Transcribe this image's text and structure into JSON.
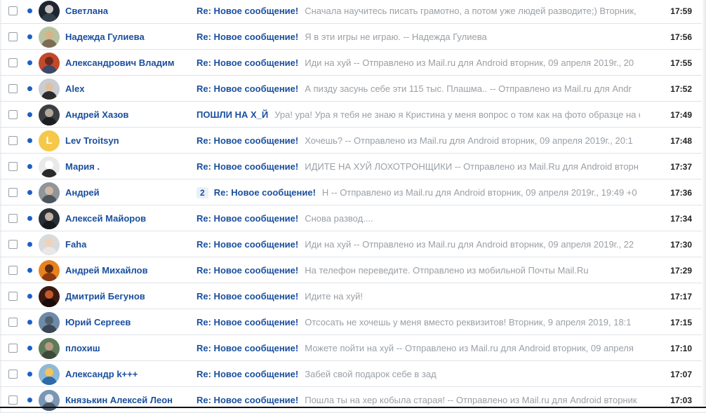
{
  "colors": {
    "link": "#1a4f9e",
    "snippet": "#9aa0a6",
    "unread_dot": "#1f5fc7",
    "row_border": "#dfe3e8"
  },
  "messages": [
    {
      "sender": "Светлана",
      "thread_count": "",
      "subject": "Re: Новое сообщение!",
      "snippet": "Сначала научитесь писать грамотно, а потом уже людей разводите;) Вторник,",
      "time": "17:59",
      "avatar": {
        "icon": "person-photo-avatar",
        "bg": "#1c2530",
        "skin": "#c9c3bf",
        "shirt": "#33404d"
      }
    },
    {
      "sender": "Надежда Гулиева",
      "thread_count": "",
      "subject": "Re: Новое сообщение!",
      "snippet": "Я в эти игры не играю. -- Надежда Гулиева",
      "time": "17:56",
      "avatar": {
        "icon": "person-photo-avatar",
        "bg": "#b9c3a0",
        "skin": "#d9b28a",
        "shirt": "#7d6b55"
      }
    },
    {
      "sender": "Александрович Владим",
      "thread_count": "",
      "subject": "Re: Новое сообщение!",
      "snippet": "Иди на хуй -- Отправлено из Mail.ru для Android вторник, 09 апреля 2019г., 20",
      "time": "17:55",
      "avatar": {
        "icon": "landscape-photo-avatar",
        "bg": "#c24a2a",
        "skin": "#6a2a20",
        "shirt": "#3a4a6a"
      }
    },
    {
      "sender": "Alex",
      "thread_count": "",
      "subject": "Re: Новое сообщение!",
      "snippet": "А пизду засунь себе эти 115 тыс. Плашма.. -- Отправлено из Mail.ru для Andr",
      "time": "17:52",
      "avatar": {
        "icon": "person-photo-avatar",
        "bg": "#c9cdd2",
        "skin": "#e0c0a0",
        "shirt": "#2b2b2b"
      }
    },
    {
      "sender": "Андрей Хазов",
      "thread_count": "",
      "subject": "ПОШЛИ НА Х_Й",
      "snippet": "Ура! ура! Ура я тебя не знаю я Кристина у меня вопрос о том как на фото образце на ф",
      "time": "17:49",
      "avatar": {
        "icon": "person-photo-avatar",
        "bg": "#3a3f44",
        "skin": "#b4a89a",
        "shirt": "#1b1f22"
      }
    },
    {
      "sender": "Lev Troitsyn",
      "thread_count": "",
      "subject": "Re: Новое сообщение!",
      "snippet": "Хочешь? -- Отправлено из Mail.ru для Android вторник, 09 апреля 2019г., 20:1",
      "time": "17:48",
      "avatar": {
        "icon": "letter-avatar",
        "letter": "L",
        "bg": "#f6c84a"
      }
    },
    {
      "sender": "Мария .",
      "thread_count": "",
      "subject": "Re: Новое сообщение!",
      "snippet": "ИДИТЕ НА ХУЙ ЛОХОТРОНЩИКИ -- Отправлено из Mail.Ru для Android вторн",
      "time": "17:37",
      "avatar": {
        "icon": "person-photo-avatar",
        "bg": "#e9e9e9",
        "skin": "#ffffff",
        "shirt": "#2a2a2a"
      }
    },
    {
      "sender": "Андрей",
      "thread_count": "2",
      "subject": "Re: Новое сообщение!",
      "snippet": "Н -- Отправлено из Mail.ru для Android вторник, 09 апреля 2019г., 19:49 +0",
      "time": "17:36",
      "avatar": {
        "icon": "person-photo-avatar",
        "bg": "#8e959b",
        "skin": "#d2b7a0",
        "shirt": "#4d555c"
      }
    },
    {
      "sender": "Алексей Майоров",
      "thread_count": "",
      "subject": "Re: Новое сообщение!",
      "snippet": "Снова развод....",
      "time": "17:34",
      "avatar": {
        "icon": "person-photo-avatar",
        "bg": "#2a2f36",
        "skin": "#c3b2a3",
        "shirt": "#161a1f"
      }
    },
    {
      "sender": "Faha",
      "thread_count": "",
      "subject": "Re: Новое сообщение!",
      "snippet": "Иди на хуй -- Отправлено из Mail.ru для Android вторник, 09 апреля 2019г., 22",
      "time": "17:30",
      "avatar": {
        "icon": "person-photo-avatar",
        "bg": "#d9dadc",
        "skin": "#f0d2b8",
        "shirt": "#e8e8e8"
      }
    },
    {
      "sender": "Андрей Михайлов",
      "thread_count": "",
      "subject": "Re: Новое сообщение!",
      "snippet": "На телефон переведите. Отправлено из мобильной Почты Mail.Ru",
      "time": "17:29",
      "avatar": {
        "icon": "sunset-photo-avatar",
        "bg": "#e8821f",
        "skin": "#5a2a10",
        "shirt": "#8a3a10"
      }
    },
    {
      "sender": "Дмитрий Бегунов",
      "thread_count": "",
      "subject": "Re: Новое сообщение!",
      "snippet": "Идите на хуй!",
      "time": "17:17",
      "avatar": {
        "icon": "person-photo-avatar",
        "bg": "#3a1a12",
        "skin": "#c25a2a",
        "shirt": "#1a0a08"
      }
    },
    {
      "sender": "Юрий Сергеев",
      "thread_count": "",
      "subject": "Re: Новое сообщение!",
      "snippet": "Отсосать не хочешь у меня вместо реквизитов! Вторник, 9 апреля 2019, 18:1",
      "time": "17:15",
      "avatar": {
        "icon": "landscape-photo-avatar",
        "bg": "#6d8aa8",
        "skin": "#51606d",
        "shirt": "#3b4652"
      }
    },
    {
      "sender": "плохиш",
      "thread_count": "",
      "subject": "Re: Новое сообщение!",
      "snippet": "Можете пойти на хуй -- Отправлено из Mail.ru для Android вторник, 09 апреля",
      "time": "17:10",
      "avatar": {
        "icon": "person-photo-avatar",
        "bg": "#5d7a5a",
        "skin": "#b99a80",
        "shirt": "#3d4a38"
      }
    },
    {
      "sender": "Александр k+++",
      "thread_count": "",
      "subject": "Re: Новое сообщение!",
      "snippet": "Забей свой подарок себе в зад",
      "time": "17:07",
      "avatar": {
        "icon": "cartoon-avatar",
        "bg": "#8fb8d8",
        "skin": "#f2c45a",
        "shirt": "#2e6aa8"
      }
    },
    {
      "sender": "Князькин Алексей Леон",
      "thread_count": "",
      "subject": "Re: Новое сообщение!",
      "snippet": "Пошла ты на хер кобыла старая! -- Отправлено из Mail.ru для Android вторник",
      "time": "17:03",
      "avatar": {
        "icon": "landscape-photo-avatar",
        "bg": "#7a96b5",
        "skin": "#e6e9ee",
        "shirt": "#4a5a6a"
      }
    }
  ]
}
